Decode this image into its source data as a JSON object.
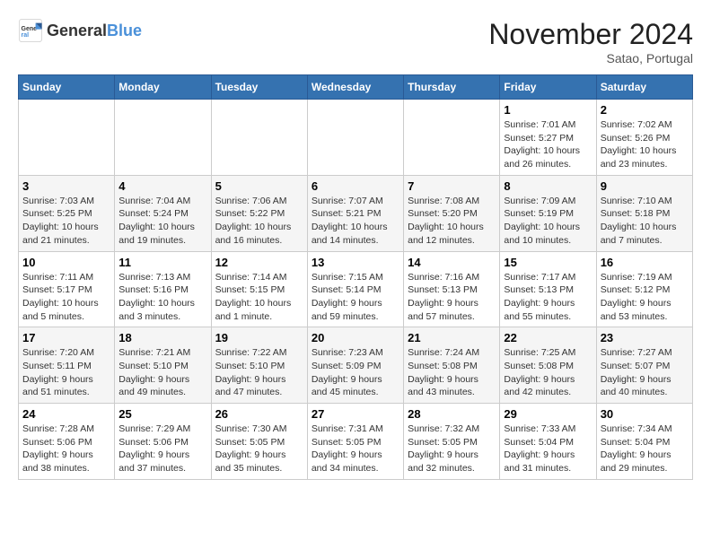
{
  "header": {
    "logo_general": "General",
    "logo_blue": "Blue",
    "month_title": "November 2024",
    "location": "Satao, Portugal"
  },
  "weekdays": [
    "Sunday",
    "Monday",
    "Tuesday",
    "Wednesday",
    "Thursday",
    "Friday",
    "Saturday"
  ],
  "weeks": [
    [
      {
        "day": "",
        "info": ""
      },
      {
        "day": "",
        "info": ""
      },
      {
        "day": "",
        "info": ""
      },
      {
        "day": "",
        "info": ""
      },
      {
        "day": "",
        "info": ""
      },
      {
        "day": "1",
        "info": "Sunrise: 7:01 AM\nSunset: 5:27 PM\nDaylight: 10 hours and 26 minutes."
      },
      {
        "day": "2",
        "info": "Sunrise: 7:02 AM\nSunset: 5:26 PM\nDaylight: 10 hours and 23 minutes."
      }
    ],
    [
      {
        "day": "3",
        "info": "Sunrise: 7:03 AM\nSunset: 5:25 PM\nDaylight: 10 hours and 21 minutes."
      },
      {
        "day": "4",
        "info": "Sunrise: 7:04 AM\nSunset: 5:24 PM\nDaylight: 10 hours and 19 minutes."
      },
      {
        "day": "5",
        "info": "Sunrise: 7:06 AM\nSunset: 5:22 PM\nDaylight: 10 hours and 16 minutes."
      },
      {
        "day": "6",
        "info": "Sunrise: 7:07 AM\nSunset: 5:21 PM\nDaylight: 10 hours and 14 minutes."
      },
      {
        "day": "7",
        "info": "Sunrise: 7:08 AM\nSunset: 5:20 PM\nDaylight: 10 hours and 12 minutes."
      },
      {
        "day": "8",
        "info": "Sunrise: 7:09 AM\nSunset: 5:19 PM\nDaylight: 10 hours and 10 minutes."
      },
      {
        "day": "9",
        "info": "Sunrise: 7:10 AM\nSunset: 5:18 PM\nDaylight: 10 hours and 7 minutes."
      }
    ],
    [
      {
        "day": "10",
        "info": "Sunrise: 7:11 AM\nSunset: 5:17 PM\nDaylight: 10 hours and 5 minutes."
      },
      {
        "day": "11",
        "info": "Sunrise: 7:13 AM\nSunset: 5:16 PM\nDaylight: 10 hours and 3 minutes."
      },
      {
        "day": "12",
        "info": "Sunrise: 7:14 AM\nSunset: 5:15 PM\nDaylight: 10 hours and 1 minute."
      },
      {
        "day": "13",
        "info": "Sunrise: 7:15 AM\nSunset: 5:14 PM\nDaylight: 9 hours and 59 minutes."
      },
      {
        "day": "14",
        "info": "Sunrise: 7:16 AM\nSunset: 5:13 PM\nDaylight: 9 hours and 57 minutes."
      },
      {
        "day": "15",
        "info": "Sunrise: 7:17 AM\nSunset: 5:13 PM\nDaylight: 9 hours and 55 minutes."
      },
      {
        "day": "16",
        "info": "Sunrise: 7:19 AM\nSunset: 5:12 PM\nDaylight: 9 hours and 53 minutes."
      }
    ],
    [
      {
        "day": "17",
        "info": "Sunrise: 7:20 AM\nSunset: 5:11 PM\nDaylight: 9 hours and 51 minutes."
      },
      {
        "day": "18",
        "info": "Sunrise: 7:21 AM\nSunset: 5:10 PM\nDaylight: 9 hours and 49 minutes."
      },
      {
        "day": "19",
        "info": "Sunrise: 7:22 AM\nSunset: 5:10 PM\nDaylight: 9 hours and 47 minutes."
      },
      {
        "day": "20",
        "info": "Sunrise: 7:23 AM\nSunset: 5:09 PM\nDaylight: 9 hours and 45 minutes."
      },
      {
        "day": "21",
        "info": "Sunrise: 7:24 AM\nSunset: 5:08 PM\nDaylight: 9 hours and 43 minutes."
      },
      {
        "day": "22",
        "info": "Sunrise: 7:25 AM\nSunset: 5:08 PM\nDaylight: 9 hours and 42 minutes."
      },
      {
        "day": "23",
        "info": "Sunrise: 7:27 AM\nSunset: 5:07 PM\nDaylight: 9 hours and 40 minutes."
      }
    ],
    [
      {
        "day": "24",
        "info": "Sunrise: 7:28 AM\nSunset: 5:06 PM\nDaylight: 9 hours and 38 minutes."
      },
      {
        "day": "25",
        "info": "Sunrise: 7:29 AM\nSunset: 5:06 PM\nDaylight: 9 hours and 37 minutes."
      },
      {
        "day": "26",
        "info": "Sunrise: 7:30 AM\nSunset: 5:05 PM\nDaylight: 9 hours and 35 minutes."
      },
      {
        "day": "27",
        "info": "Sunrise: 7:31 AM\nSunset: 5:05 PM\nDaylight: 9 hours and 34 minutes."
      },
      {
        "day": "28",
        "info": "Sunrise: 7:32 AM\nSunset: 5:05 PM\nDaylight: 9 hours and 32 minutes."
      },
      {
        "day": "29",
        "info": "Sunrise: 7:33 AM\nSunset: 5:04 PM\nDaylight: 9 hours and 31 minutes."
      },
      {
        "day": "30",
        "info": "Sunrise: 7:34 AM\nSunset: 5:04 PM\nDaylight: 9 hours and 29 minutes."
      }
    ]
  ]
}
